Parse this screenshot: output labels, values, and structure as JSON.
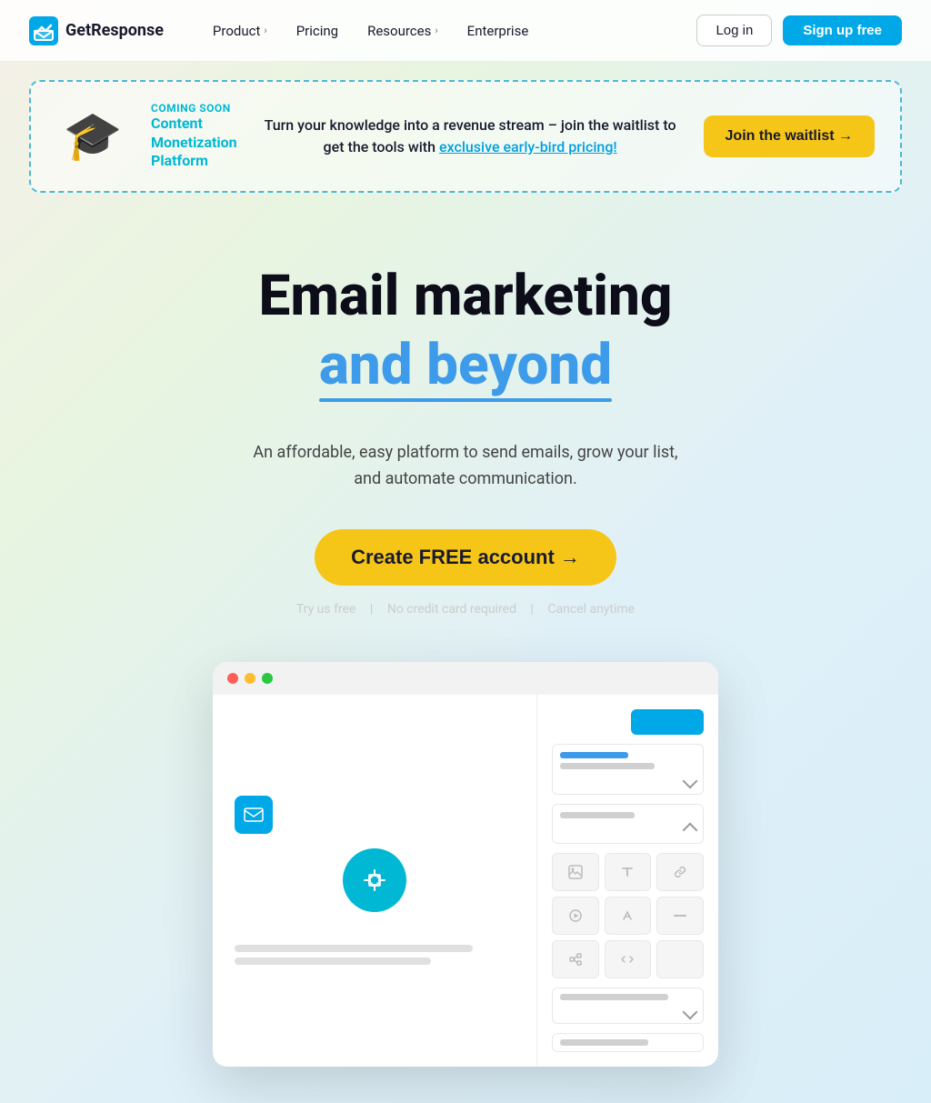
{
  "nav": {
    "logo_text": "GetResponse",
    "links": [
      {
        "label": "Product",
        "has_chevron": true
      },
      {
        "label": "Pricing",
        "has_chevron": false
      },
      {
        "label": "Resources",
        "has_chevron": true
      },
      {
        "label": "Enterprise",
        "has_chevron": false
      }
    ],
    "login_label": "Log in",
    "signup_label": "Sign up free"
  },
  "banner": {
    "coming_soon": "COMING SOON",
    "title_line1": "Content",
    "title_line2": "Monetization",
    "title_line3": "Platform",
    "body_text": "Turn your knowledge into a revenue stream – join the waitlist to get the tools with ",
    "link_text": "exclusive early-bird pricing!",
    "cta_label": "Join the waitlist →"
  },
  "hero": {
    "title_line1": "Email marketing",
    "title_line2": "and beyond",
    "description_line1": "An affordable, easy platform to send emails, grow your list,",
    "description_line2": "and automate communication.",
    "cta_label": "Create FREE account →",
    "note": {
      "part1": "Try us free",
      "sep1": "|",
      "part2": "No credit card required",
      "sep2": "|",
      "part3": "Cancel anytime"
    }
  },
  "mockup": {
    "dots": [
      "red",
      "yellow",
      "green"
    ]
  },
  "icons": {
    "logo_envelope": "✉",
    "ai_chip": "🤖",
    "email_small": "✉"
  }
}
